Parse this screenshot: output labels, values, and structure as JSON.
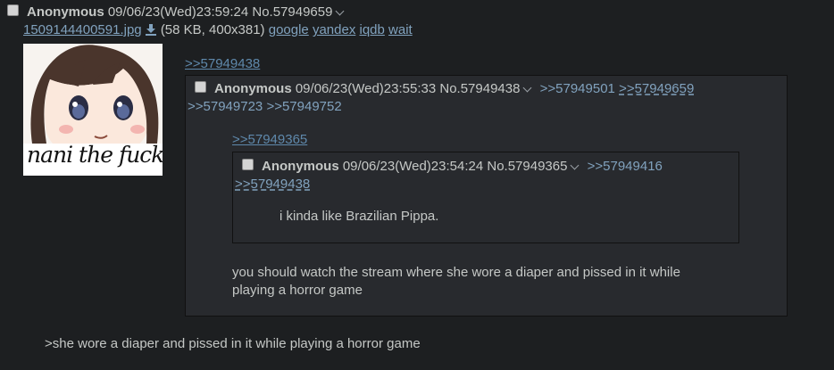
{
  "op": {
    "name": "Anonymous",
    "datetime": "09/06/23(Wed)23:59:24",
    "post_no": "No.57949659",
    "file_name": "1509144400591.jpg",
    "file_info": "(58 KB, 400x381)",
    "search_links": [
      "google",
      "yandex",
      "iqdb",
      "wait"
    ],
    "thumb_caption": "nani the fuck",
    "quote_ref": ">>57949438",
    "greentext": ">she wore a diaper and pissed in it while playing a horror game"
  },
  "reply1": {
    "name": "Anonymous",
    "datetime": "09/06/23(Wed)23:55:33",
    "post_no": "No.57949438",
    "backlinks_line1": [
      ">>57949501",
      ">>57949659"
    ],
    "backlinks_line2": [
      ">>57949723",
      ">>57949752"
    ],
    "quote_ref": ">>57949365",
    "message_line1": "you should watch the stream where she wore a diaper and pissed in it while",
    "message_line2": "playing a horror game"
  },
  "reply2": {
    "name": "Anonymous",
    "datetime": "09/06/23(Wed)23:54:24",
    "post_no": "No.57949365",
    "backlink1": ">>57949416",
    "backlink2": ">>57949438",
    "message": "i kinda like Brazilian Pippa."
  },
  "colors": {
    "background": "#1d1f21",
    "reply_bg": "#282a2e",
    "link": "#81a2be",
    "greentext": "#b5bd68",
    "text": "#c5c8c6"
  }
}
